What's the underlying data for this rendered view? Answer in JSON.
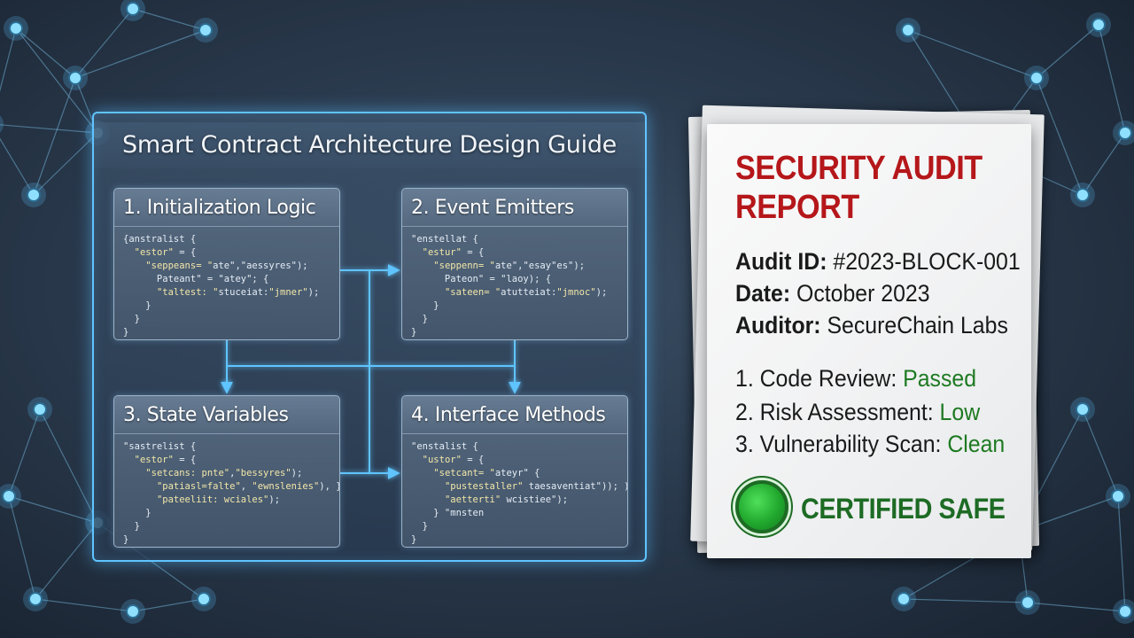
{
  "guide": {
    "title": "Smart Contract Architecture Design Guide",
    "modules": [
      {
        "title": "1. Initialization Logic",
        "code": [
          "{anstralist {",
          "  \"estor\" = {",
          "    \"seppeans= \"ate\",\"aessyres\");",
          "      Pateant\" = \"atey\"; {",
          "      \"taltest: \"stuceiat:\"jmner\");",
          "    }",
          "  }",
          "}"
        ]
      },
      {
        "title": "2. Event Emitters",
        "code": [
          "\"enstellat {",
          "  \"estur\" = {",
          "    \"seppenn= \"ate\",\"esay\"es\");",
          "      Pateon\" = \"laoy); {",
          "      \"sateen= \"atutteiat:\"jmnoc\");",
          "    }",
          "  }",
          "}"
        ]
      },
      {
        "title": "3. State Variables",
        "code": [
          "\"sastrelist {",
          "  \"estor\" = {",
          "    \"setcans: pnte\",\"bessyres\");",
          "      \"patiasl=falte\", \"ewnslenies\"), }",
          "      \"pateeliit: wciales\");",
          "    }",
          "  }",
          "}"
        ]
      },
      {
        "title": "4. Interface Methods",
        "code": [
          "\"enstalist {",
          "  \"ustor\" = {",
          "    \"setcant= \"ateyr\" {",
          "      \"pustestaller\" taesaventiat\")); );",
          "      \"aetterti\" wcistiee\");",
          "    } \"mnsten",
          "  }",
          "}"
        ]
      }
    ]
  },
  "report": {
    "title": "SECURITY AUDIT REPORT",
    "meta": [
      {
        "key": "Audit ID:",
        "value": "#2023-BLOCK-001"
      },
      {
        "key": "Date:",
        "value": "October 2023"
      },
      {
        "key": "Auditor:",
        "value": "SecureChain Labs"
      }
    ],
    "checks": [
      {
        "label": "1. Code Review:",
        "result": "Passed"
      },
      {
        "label": "2. Risk Assessment:",
        "result": "Low"
      },
      {
        "label": "3. Vulnerability Scan:",
        "result": "Clean"
      }
    ],
    "certification": "CERTIFIED SAFE"
  },
  "colors": {
    "accent_glow": "#5fc4ff",
    "report_title": "#b5171a",
    "result_green": "#1e7a22",
    "cert_green": "#1d6b24"
  }
}
